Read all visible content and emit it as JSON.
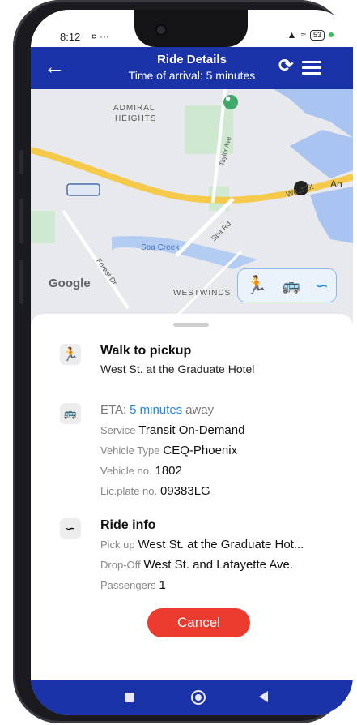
{
  "status": {
    "time": "8:12",
    "icons_left": "¤ ···",
    "battery": "53"
  },
  "header": {
    "title": "Ride Details",
    "subtitle": "Time of arrival: 5 minutes"
  },
  "map": {
    "labels": {
      "admiral": "ADMIRAL",
      "heights": "HEIGHTS",
      "taylor": "Taylor Ave",
      "west_st": "West St",
      "annapolis": "An",
      "spa_rd": "Spa Rd",
      "spa_creek": "Spa Creek",
      "forest_dr": "Forest Dr",
      "westwinds": "WESTWINDS"
    },
    "attribution": "Google"
  },
  "modes": [
    {
      "icon": "walk-icon"
    },
    {
      "icon": "bus-icon"
    },
    {
      "icon": "route-icon"
    }
  ],
  "walk": {
    "title": "Walk to pickup",
    "location": "West St. at the Graduate Hotel"
  },
  "vehicle": {
    "eta_label": "ETA:",
    "eta_value": "5 minutes",
    "eta_suffix": "away",
    "service_label": "Service",
    "service_value": "Transit On-Demand",
    "type_label": "Vehicle Type",
    "type_value": "CEQ-Phoenix",
    "no_label": "Vehicle no.",
    "no_value": "1802",
    "plate_label": "Lic.plate no.",
    "plate_value": "09383LG"
  },
  "ride": {
    "title": "Ride info",
    "pickup_label": "Pick up",
    "pickup_value": "West St. at the Graduate Hot...",
    "dropoff_label": "Drop-Off",
    "dropoff_value": "West St. and Lafayette Ave.",
    "passengers_label": "Passengers",
    "passengers_value": "1"
  },
  "cancel_label": "Cancel",
  "colors": {
    "header": "#1a33a8",
    "accent": "#1f88e5",
    "cancel": "#ea3b2e"
  }
}
